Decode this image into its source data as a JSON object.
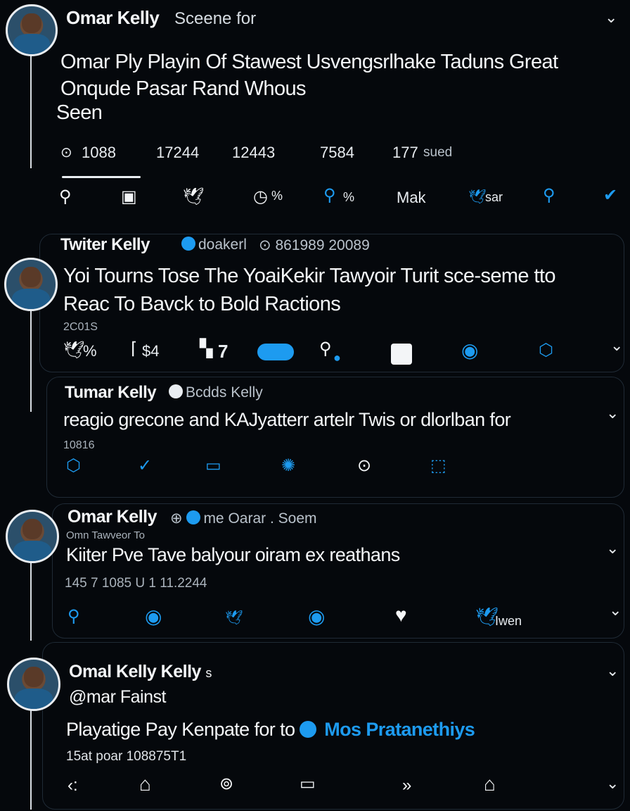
{
  "colors": {
    "accent": "#1d9bf0",
    "background": "#05080c",
    "text": "#f4f6f8"
  },
  "tweet1": {
    "name": "Omar Kelly",
    "handle": "Sceene for",
    "text_lines": [
      "Omar Ply Playin Of Stawest Usvengsrlhake Taduns Great",
      "Onqude Pasar Rand Whous",
      "Seen"
    ],
    "stats": [
      "1088",
      "17244",
      "12443",
      "7584",
      "177"
    ],
    "stats_suffix": "sued",
    "actions": [
      "%",
      "%",
      "Mak",
      "sar"
    ],
    "icons": [
      "search-icon",
      "square-icon",
      "bird-icon",
      "clock-icon",
      "search-icon",
      "bird-icon",
      "search-icon",
      "check-icon"
    ]
  },
  "tweet2": {
    "name": "Twiter Kelly",
    "handle": "doakerl",
    "meta": "861989 20089",
    "text_lines": [
      "Yoi Tourns Tose The YoaiKekir Tawyoir Turit sce-seme tto",
      "Reac To Bavck to Bold Ractions"
    ],
    "time": "2C01S",
    "actions": [
      "%",
      "$4",
      "7"
    ]
  },
  "tweet3": {
    "name": "Tumar Kelly",
    "handle": "Bcdds Kelly",
    "text": "reagio grecone and  KAJyatterr artelr Twis or dlorlban for",
    "time": "10816"
  },
  "tweet4": {
    "name": "Omar Kelly",
    "handle": "me Oarar . Soem",
    "subhandle": "Omn Tawveor     To",
    "text": "Kiiter Pve Tave balyour oiram ex reathans",
    "stats": "145 7 1085   U  1  11.2244",
    "actions": [
      "Iwen"
    ]
  },
  "tweet5": {
    "name": "Omal Kelly Kelly",
    "name_suffix": "s",
    "handle": "@mar Fainst",
    "text_prefix": "Playatige Pay Kenpate for to",
    "text_link": "Mos Pratanethiys",
    "time": "15at poar 108875T1"
  }
}
